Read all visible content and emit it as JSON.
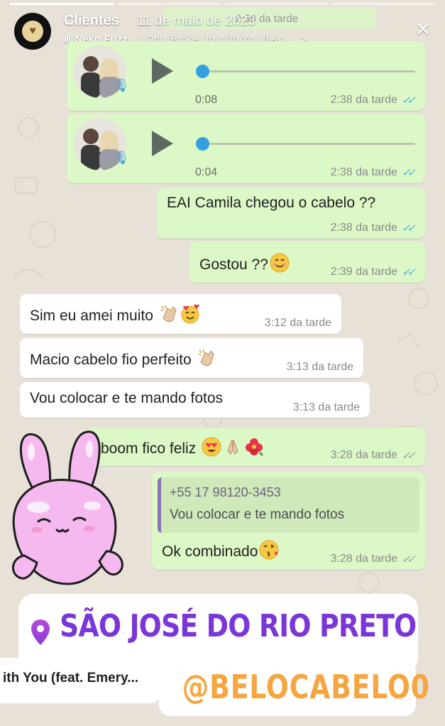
{
  "story": {
    "progress_segments": 4,
    "progress_done": 1,
    "account_name": "Clientes",
    "date": "11 de maio de 2023",
    "music_artist": "Neko Fuzz",
    "music_separator": "·",
    "music_title": "I Only Broke Up With You (feat....",
    "music_chevron": ">",
    "close_icon": "×"
  },
  "chat": {
    "top_partial_time": "2:38 da tarde",
    "voice_notes": [
      {
        "duration": "0:08",
        "time": "2:38 da tarde",
        "status": "read"
      },
      {
        "duration": "0:04",
        "time": "2:38 da tarde",
        "status": "read"
      }
    ],
    "messages": [
      {
        "text": "EAI Camila chegou o cabelo ??",
        "time": "2:38 da tarde",
        "direction": "out",
        "status": "read"
      },
      {
        "text": "Gostou ??",
        "emoji": "smile-emoji",
        "time": "2:39 da tarde",
        "direction": "out",
        "status": "read"
      },
      {
        "text": "Sim eu amei muito",
        "emoji": "clap-hearts-emoji",
        "time": "3:12 da tarde",
        "direction": "in"
      },
      {
        "text": "Macio cabelo fio perfeito",
        "emoji": "clap-emoji",
        "time": "3:13 da tarde",
        "direction": "in"
      },
      {
        "text": "Vou colocar e te mando fotos",
        "time": "3:13 da tarde",
        "direction": "in"
      },
      {
        "text": "boom fico feliz",
        "emoji": "heart-eyes-pray-flower-emoji",
        "time": "3:28 da tarde",
        "direction": "out",
        "status": "delivered"
      },
      {
        "quote_number": "+55 17 98120-3453",
        "quote_text": "Vou colocar e te mando fotos",
        "text": "Ok combinado",
        "emoji": "kiss-emoji",
        "time": "3:28 da tarde",
        "direction": "out",
        "status": "delivered"
      }
    ]
  },
  "stickers": {
    "location": "SÃO JOSÉ DO RIO PRETO",
    "music_snippet": "ith You (feat. Emery...",
    "handle": "@BELOCABELO0"
  },
  "colors": {
    "outgoing_bubble": "#dcf8c6",
    "incoming_bubble": "#ffffff",
    "read_ticks": "#4fa8e8",
    "location_gradient_start": "#7a36d8",
    "location_gradient_end": "#c84fd6",
    "handle_gradient_start": "#f6a640",
    "handle_gradient_end": "#f4c24a",
    "bunny_pink": "#f5b9ef"
  }
}
